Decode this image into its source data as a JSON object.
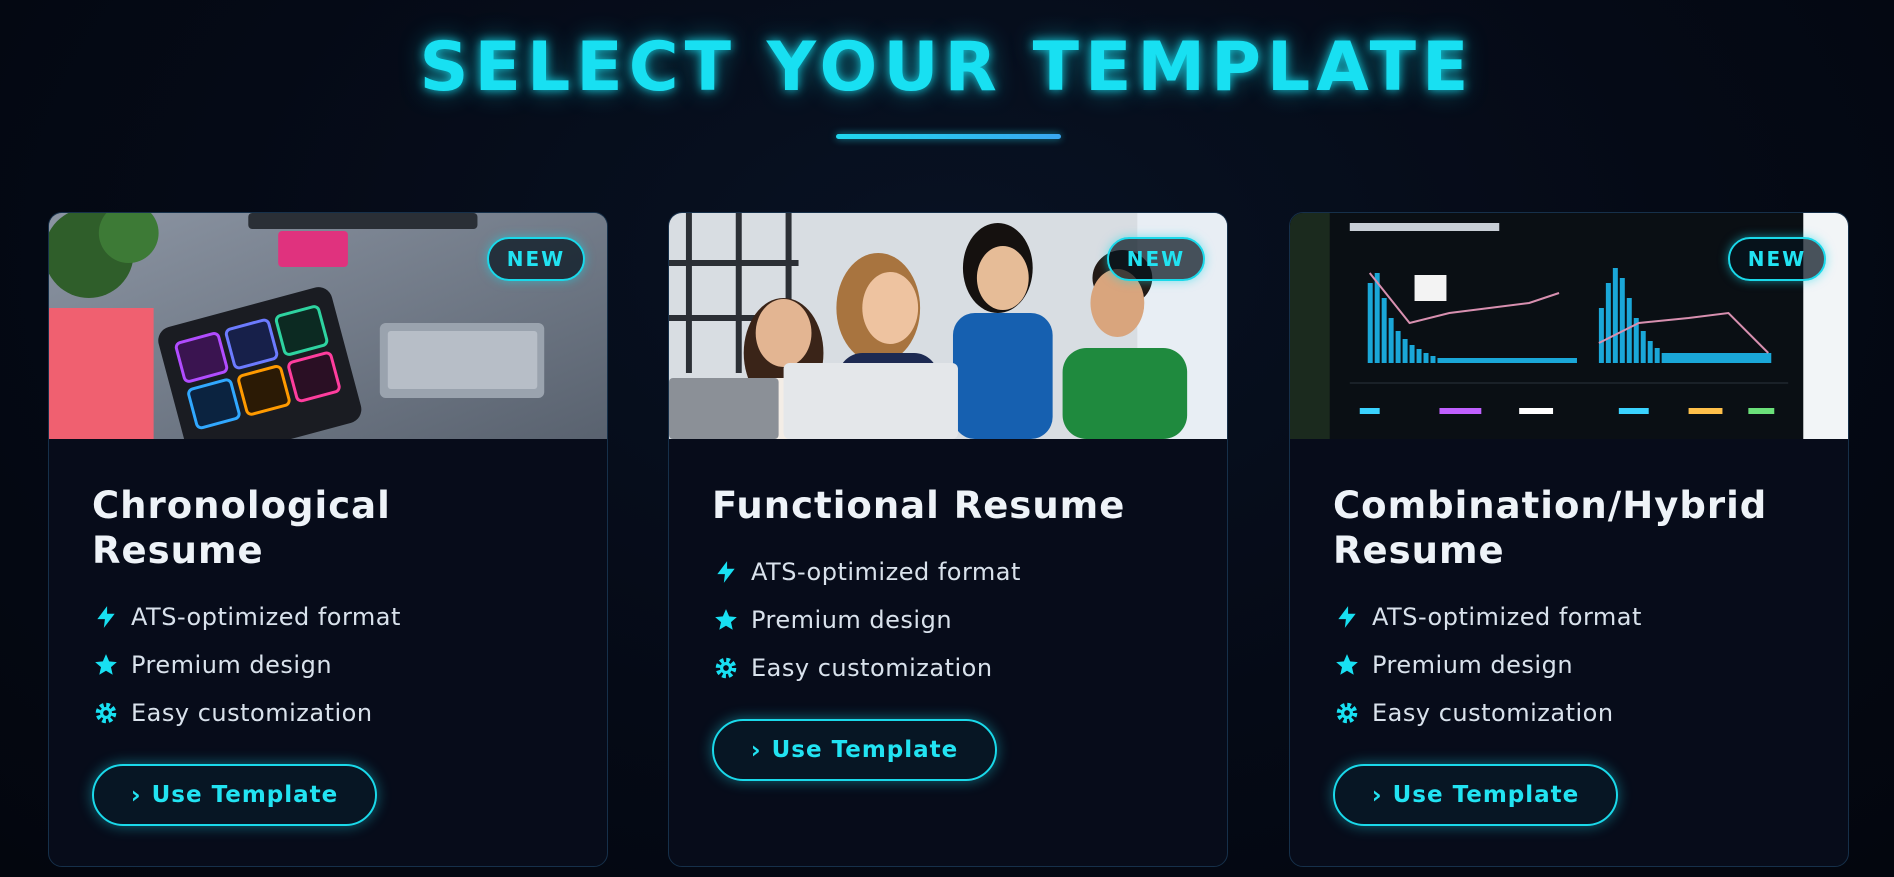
{
  "page": {
    "title": "SELECT YOUR TEMPLATE"
  },
  "colors": {
    "accent": "#18e0f2",
    "background": "#050a16",
    "card": "#070c1a"
  },
  "templates": [
    {
      "badge": "NEW",
      "title": "Chronological Resume",
      "image": "design-desk-photo",
      "features": [
        {
          "icon": "bolt-icon",
          "label": "ATS-optimized format"
        },
        {
          "icon": "star-icon",
          "label": "Premium design"
        },
        {
          "icon": "gear-icon",
          "label": "Easy customization"
        }
      ],
      "button": "Use Template"
    },
    {
      "badge": "NEW",
      "title": "Functional Resume",
      "image": "team-laptop-photo",
      "features": [
        {
          "icon": "bolt-icon",
          "label": "ATS-optimized format"
        },
        {
          "icon": "star-icon",
          "label": "Premium design"
        },
        {
          "icon": "gear-icon",
          "label": "Easy customization"
        }
      ],
      "button": "Use Template"
    },
    {
      "badge": "NEW",
      "title": "Combination/Hybrid Resume",
      "image": "analytics-dashboard-photo",
      "features": [
        {
          "icon": "bolt-icon",
          "label": "ATS-optimized format"
        },
        {
          "icon": "star-icon",
          "label": "Premium design"
        },
        {
          "icon": "gear-icon",
          "label": "Easy customization"
        }
      ],
      "button": "Use Template"
    }
  ]
}
